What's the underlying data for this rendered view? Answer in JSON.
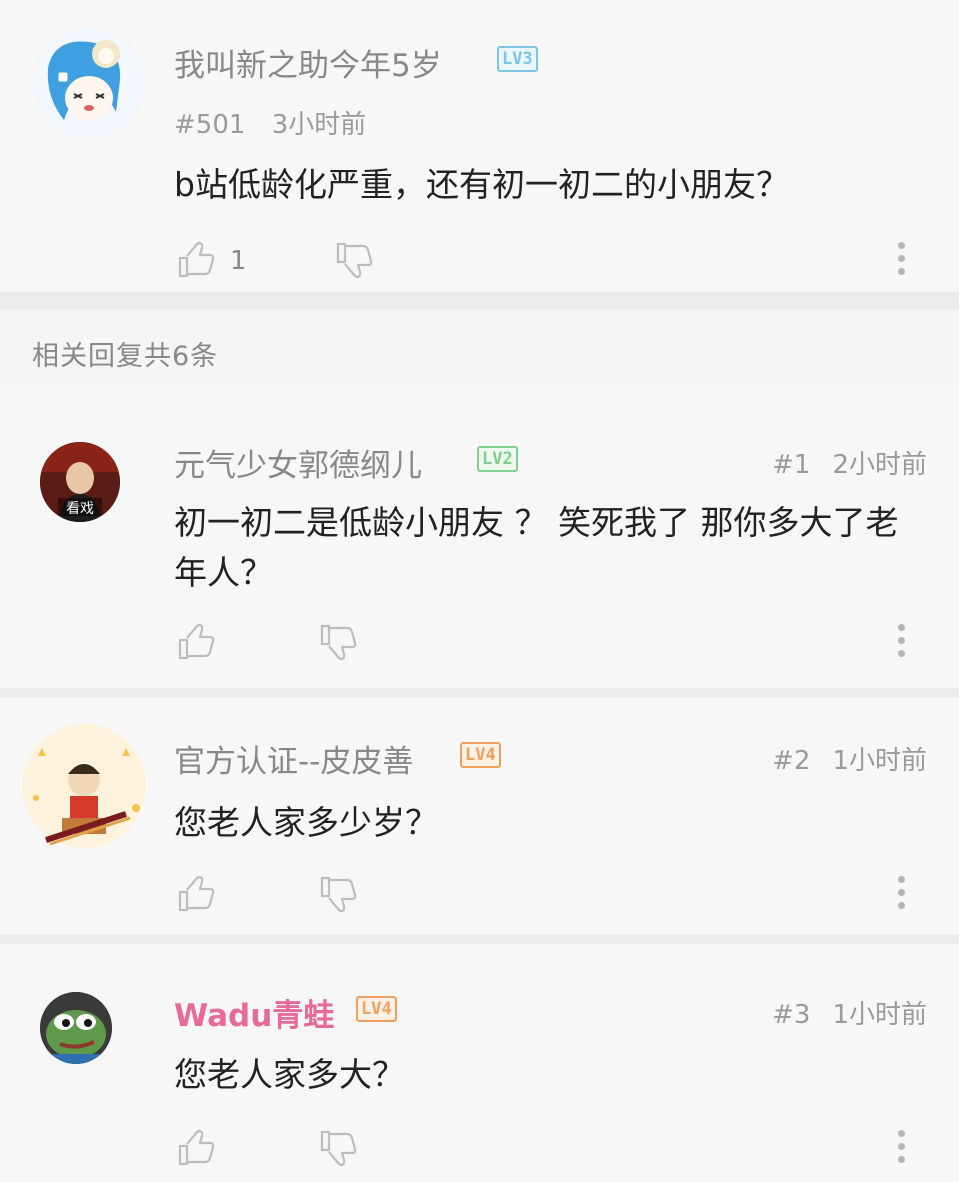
{
  "root_comment": {
    "username": "我叫新之助今年5岁",
    "level": "LV3",
    "floor": "#501",
    "time": "3小时前",
    "content": "b站低龄化严重，还有初一初二的小朋友？",
    "like_count": "1"
  },
  "replies_header": "相关回复共6条",
  "replies": [
    {
      "username": "元气少女郭德纲儿",
      "level": "LV2",
      "floor": "#1",
      "time": "2小时前",
      "content": "初一初二是低龄小朋友 ？ 笑死我了 那你多大了老年人？",
      "avatar_text": "看戏"
    },
    {
      "username": "官方认证--皮皮善",
      "level": "LV4",
      "floor": "#2",
      "time": "1小时前",
      "content": "您老人家多少岁？"
    },
    {
      "username": "Wadu青蛙",
      "level": "LV4",
      "floor": "#3",
      "time": "1小时前",
      "content": "您老人家多大？"
    }
  ],
  "colors": {
    "lv2": "#7fd08e",
    "lv3": "#7cc3e6",
    "lv4": "#f0a05c",
    "vip_name": "#e86a97"
  }
}
